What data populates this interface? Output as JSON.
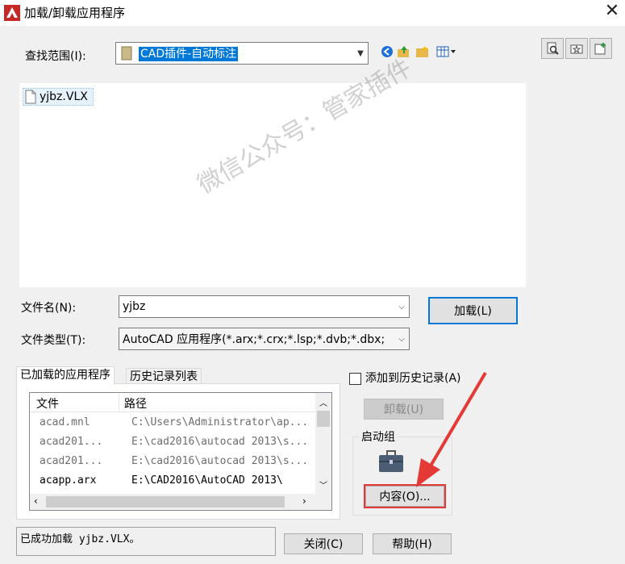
{
  "window": {
    "title": "加载/卸载应用程序",
    "close_glyph": "✕"
  },
  "lookin": {
    "label": "查找范围(I):",
    "value": "CAD插件-自动标注"
  },
  "files": [
    {
      "name": "yjbz.VLX"
    }
  ],
  "filename": {
    "label": "文件名(N):",
    "value": "yjbz"
  },
  "filetype": {
    "label": "文件类型(T):",
    "value": "AutoCAD 应用程序(*.arx;*.crx;*.lsp;*.dvb;*.dbx;"
  },
  "load_button": "加载(L)",
  "tabs": [
    {
      "label": "已加载的应用程序"
    },
    {
      "label": "历史记录列表"
    }
  ],
  "loaded_table": {
    "columns": [
      "文件",
      "路径"
    ],
    "rows": [
      {
        "file": "acad.mnl",
        "path": "C:\\Users\\Administrator\\ap..."
      },
      {
        "file": "acad201...",
        "path": "E:\\cad2016\\autocad 2013\\s..."
      },
      {
        "file": "acad201...",
        "path": "E:\\cad2016\\autocad 2013\\s..."
      },
      {
        "file": "acapp.arx",
        "path": "E:\\CAD2016\\AutoCAD 2013\\"
      }
    ]
  },
  "add_history": {
    "label": "添加到历史记录(A)",
    "checked": false
  },
  "unload_button": "卸载(U)",
  "startup_group": {
    "title": "启动组",
    "contents_button": "内容(O)..."
  },
  "status_text": "已成功加载 yjbz.VLX。",
  "close_button": "关闭(C)",
  "help_button": "帮助(H)",
  "watermark": "微信公众号：管家插件",
  "colors": {
    "selection": "#0078d7",
    "highlight": "#e53935",
    "background": "#f0f0f0"
  },
  "icons": {
    "app": "autocad-app-icon",
    "back": "back-arrow-icon",
    "up": "up-folder-icon",
    "newfolder": "new-folder-icon",
    "views": "views-menu-icon",
    "find": "find-file-icon",
    "locate": "locate-folder-icon",
    "favorites": "add-favorites-icon",
    "briefcase": "briefcase-icon"
  }
}
